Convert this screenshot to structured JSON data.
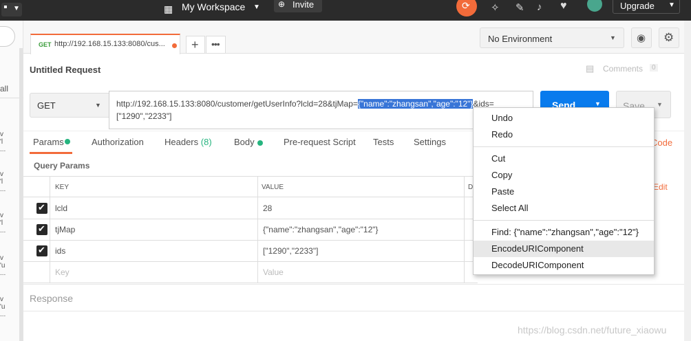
{
  "topbar": {
    "workspace": "My Workspace",
    "invite": "Invite",
    "upgrade": "Upgrade"
  },
  "request_tab": {
    "method": "GET",
    "url_short": "http://192.168.15.133:8080/cus..."
  },
  "environment": "No Environment",
  "request_title": "Untitled Request",
  "comments": {
    "label": "Comments",
    "count": "0"
  },
  "url_bar": {
    "method": "GET",
    "url_before": "http://192.168.15.133:8080/customer/getUserInfo?lcld=28&tjMap=",
    "url_selected": "{\"name\":\"zhangsan\",\"age\":\"12\"}",
    "url_after": "&ids=",
    "url_line2": "[\"1290\",\"2233\"]",
    "send": "Send",
    "save": "Save"
  },
  "tabs": [
    {
      "label": "Params"
    },
    {
      "label": "Authorization"
    },
    {
      "label": "Headers",
      "count": "(8)"
    },
    {
      "label": "Body"
    },
    {
      "label": "Pre-request Script"
    },
    {
      "label": "Tests"
    },
    {
      "label": "Settings"
    }
  ],
  "right_links": {
    "code": "Code",
    "edit": "Edit"
  },
  "query_params": {
    "title": "Query Params",
    "headers": [
      "KEY",
      "VALUE",
      "D"
    ],
    "rows": [
      {
        "key": "lcld",
        "value": "28"
      },
      {
        "key": "tjMap",
        "value": "{\"name\":\"zhangsan\",\"age\":\"12\"}"
      },
      {
        "key": "ids",
        "value": "[\"1290\",\"2233\"]"
      }
    ],
    "placeholder_key": "Key",
    "placeholder_value": "Value"
  },
  "response_label": "Response",
  "context_menu": {
    "undo": "Undo",
    "redo": "Redo",
    "cut": "Cut",
    "copy": "Copy",
    "paste": "Paste",
    "select_all": "Select All",
    "find": "Find: {\"name\":\"zhangsan\",\"age\":\"12\"}",
    "encode": "EncodeURIComponent",
    "decode": "DecodeURIComponent"
  },
  "sidebar_left": {
    "all": "all"
  },
  "watermark": "https://blog.csdn.net/future_xiaowu",
  "colors": {
    "accent": "#f26b3a",
    "send_blue": "#097bed",
    "selection": "#3875d7",
    "green_dot": "#26b47f"
  }
}
